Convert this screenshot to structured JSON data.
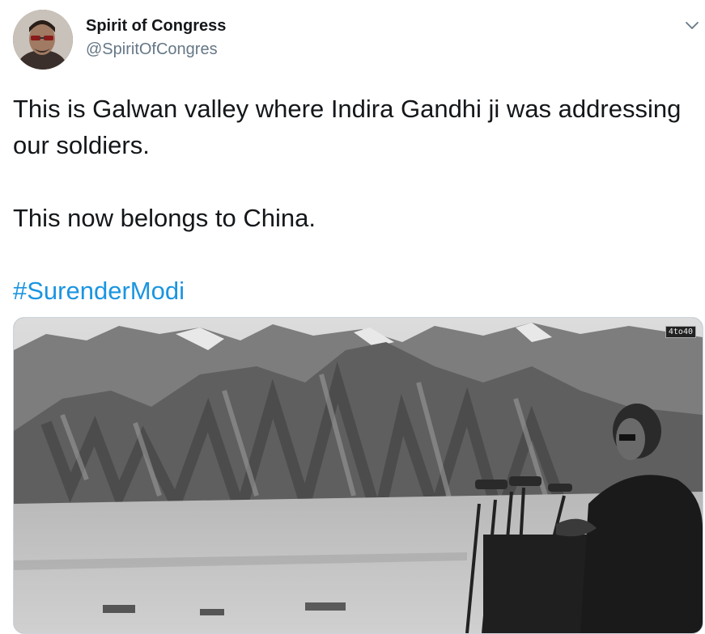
{
  "tweet": {
    "author_name": "Spirit of Congress",
    "author_handle": "@SpiritOfCongres",
    "text_line_1": "This is Galwan valley where Indira Gandhi ji was addressing our soldiers.",
    "text_line_2": "This now belongs to China.",
    "hashtag": "#SurenderModi",
    "media_watermark": "4to40"
  },
  "icons": {
    "menu": "chevron-down-icon"
  },
  "colors": {
    "text": "#14171a",
    "secondary_text": "#657786",
    "link": "#1b95e0",
    "border": "#ccd6dd"
  }
}
